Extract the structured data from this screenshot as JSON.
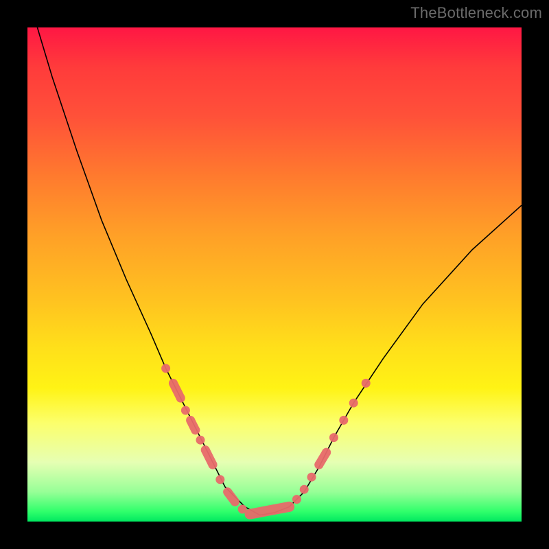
{
  "watermark": "TheBottleneck.com",
  "chart_data": {
    "type": "line",
    "title": "",
    "xlabel": "",
    "ylabel": "",
    "xlim": [
      0,
      100
    ],
    "ylim": [
      0,
      100
    ],
    "series": [
      {
        "name": "curve",
        "x": [
          2,
          5,
          10,
          15,
          20,
          25,
          28,
          31,
          34,
          36,
          38,
          40,
          42,
          44,
          47,
          50,
          53,
          56,
          59,
          62,
          66,
          72,
          80,
          90,
          100
        ],
        "values": [
          100,
          90,
          75,
          61,
          49,
          38,
          31,
          25,
          19,
          15,
          11,
          7,
          5,
          3,
          1.3,
          1.8,
          3,
          6,
          11,
          17,
          24,
          33,
          44,
          55,
          64
        ]
      }
    ],
    "beads": {
      "left": [
        {
          "x": 28.0,
          "y": 31.0
        },
        {
          "x": 29.5,
          "y": 28.0
        },
        {
          "x": 31.0,
          "y": 25.0
        },
        {
          "x": 32.0,
          "y": 22.5
        },
        {
          "x": 33.0,
          "y": 20.5
        },
        {
          "x": 34.0,
          "y": 18.5
        },
        {
          "x": 35.0,
          "y": 16.5
        },
        {
          "x": 36.0,
          "y": 14.5
        },
        {
          "x": 37.5,
          "y": 11.5
        },
        {
          "x": 39.0,
          "y": 8.5
        },
        {
          "x": 40.5,
          "y": 6.0
        },
        {
          "x": 42.0,
          "y": 4.0
        },
        {
          "x": 43.5,
          "y": 2.5
        }
      ],
      "bottom": [
        {
          "x": 45.0,
          "y": 1.5
        },
        {
          "x": 47.0,
          "y": 1.2
        },
        {
          "x": 49.0,
          "y": 1.6
        },
        {
          "x": 51.0,
          "y": 2.2
        },
        {
          "x": 53.0,
          "y": 3.0
        }
      ],
      "right": [
        {
          "x": 54.5,
          "y": 4.5
        },
        {
          "x": 56.0,
          "y": 6.5
        },
        {
          "x": 57.5,
          "y": 9.0
        },
        {
          "x": 59.0,
          "y": 11.5
        },
        {
          "x": 60.5,
          "y": 14.0
        },
        {
          "x": 62.0,
          "y": 17.0
        },
        {
          "x": 64.0,
          "y": 20.5
        },
        {
          "x": 66.0,
          "y": 24.0
        },
        {
          "x": 68.5,
          "y": 28.0
        }
      ]
    }
  }
}
